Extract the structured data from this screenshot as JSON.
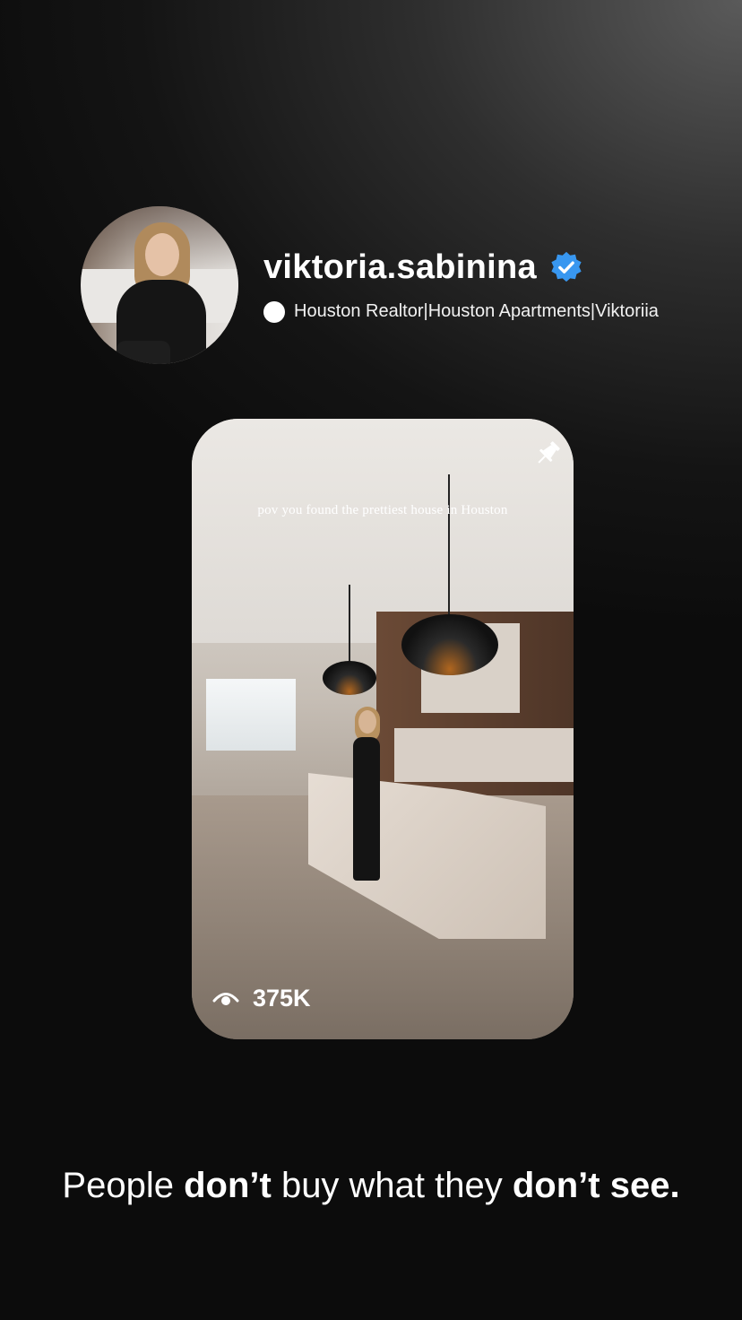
{
  "profile": {
    "username": "viktoria.sabinina",
    "bio": "Houston Realtor|Houston Apartments|Viktoriia"
  },
  "post": {
    "caption": "pov you found the prettiest house in Houston",
    "views": "375K"
  },
  "tagline": {
    "part1": "People ",
    "bold1": "don’t",
    "part2": " buy what they ",
    "bold2": "don’t see."
  },
  "colors": {
    "verified": "#3897f0",
    "background": "#141414",
    "text": "#ffffff"
  },
  "icons": [
    "verified-badge-icon",
    "pin-icon",
    "eye-icon"
  ]
}
